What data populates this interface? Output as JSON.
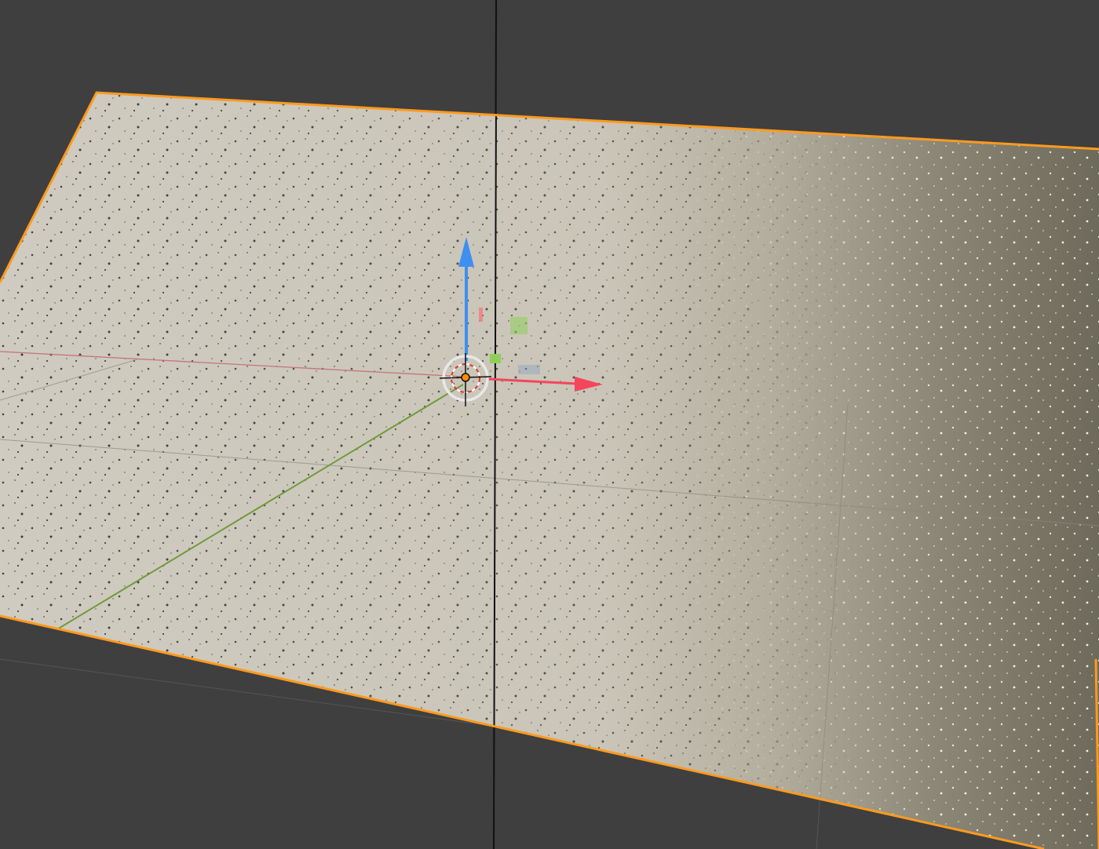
{
  "viewport": {
    "colors": {
      "background": "#3f3f3f",
      "selection_outline": "#ff9a1f",
      "axis_x": "#c8737a",
      "axis_y": "#6f9a3a",
      "gizmo_x": "#f5455c",
      "gizmo_y": "#8fcf58",
      "gizmo_z": "#3f8ff0",
      "origin": "#ff8c00",
      "plane_light": "#cfcbc0",
      "plane_dark": "#6e6a5b"
    },
    "selected_object": {
      "type": "plane",
      "selected": true,
      "active": true
    },
    "gizmo": {
      "mode": "move",
      "handles": [
        "x-axis-arrow",
        "y-axis-arrow",
        "z-axis-arrow",
        "xz-plane-handle",
        "yz-plane-handle",
        "xy-plane-handle"
      ]
    },
    "icons": {
      "cursor": "3d-cursor-icon",
      "origin": "object-origin-icon"
    }
  }
}
